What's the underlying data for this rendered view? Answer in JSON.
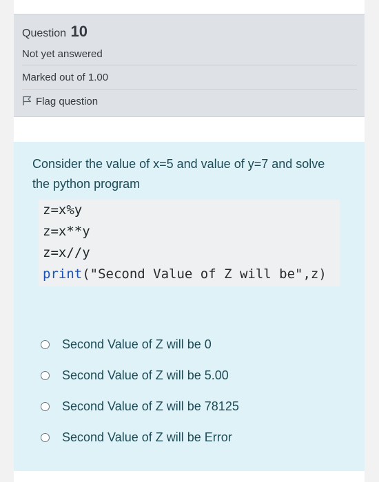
{
  "question": {
    "label": "Question",
    "number": "10",
    "state": "Not yet answered",
    "grade": "Marked out of 1.00",
    "flag_label": "Flag question"
  },
  "prompt": {
    "text": "Consider the value of x=5 and value of y=7 and solve the python program"
  },
  "code": {
    "line1": "z=x%y",
    "line2": "z=x**y",
    "line3": "z=x//y",
    "line4_fn": "print",
    "line4_rest": "(\"Second Value of Z will be\",z)"
  },
  "answers": [
    {
      "label": "Second Value of Z will be 0"
    },
    {
      "label": "Second Value of Z will be 5.00"
    },
    {
      "label": "Second Value of Z will be 78125"
    },
    {
      "label": "Second Value of Z will be Error"
    }
  ],
  "colors": {
    "info_bg": "#dee2e6",
    "formulation_bg": "#def2f8",
    "code_bg": "#eef0f1",
    "keyword": "#1a52b8"
  },
  "icons": {
    "flag": "flag-icon"
  }
}
